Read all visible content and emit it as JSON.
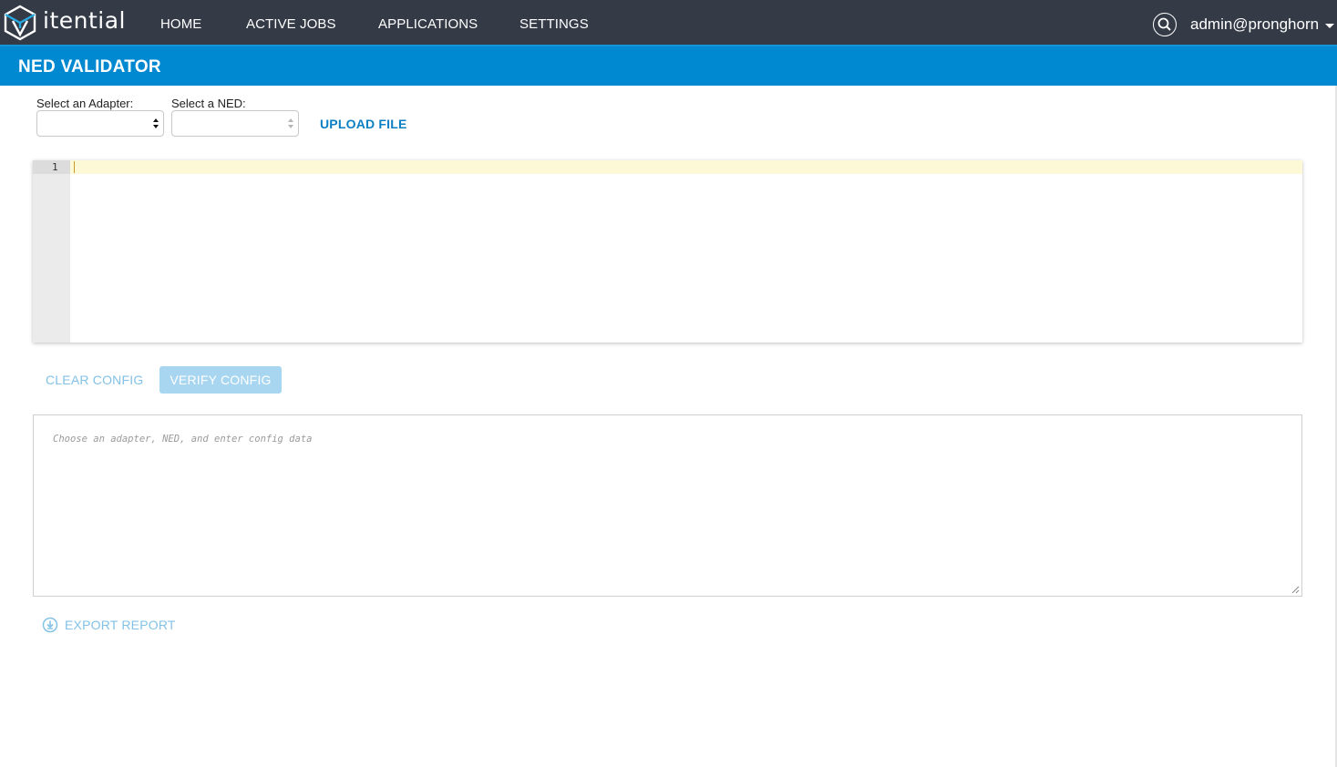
{
  "app": {
    "logo_text": "itential",
    "colors": {
      "nav_bg": "#343a46",
      "title_bar": "#0088d1",
      "accent": "#0a7fc2",
      "muted_accent": "#83c2e7"
    }
  },
  "nav": {
    "items": [
      {
        "label": "HOME"
      },
      {
        "label": "ACTIVE JOBS"
      },
      {
        "label": "APPLICATIONS"
      },
      {
        "label": "SETTINGS"
      }
    ],
    "search_icon": "search-icon",
    "user": "admin@pronghorn"
  },
  "page": {
    "title": "NED VALIDATOR"
  },
  "form": {
    "adapter_label": "Select an Adapter:",
    "adapter_value": "",
    "ned_label": "Select a NED:",
    "ned_value": "",
    "upload_label": "UPLOAD FILE"
  },
  "editor": {
    "line_numbers": [
      "1"
    ],
    "content": ""
  },
  "actions": {
    "clear_label": "CLEAR CONFIG",
    "verify_label": "VERIFY CONFIG"
  },
  "result": {
    "placeholder": "Choose an adapter, NED, and enter config data",
    "value": ""
  },
  "export": {
    "label": "EXPORT REPORT",
    "icon": "download-circle-icon"
  }
}
